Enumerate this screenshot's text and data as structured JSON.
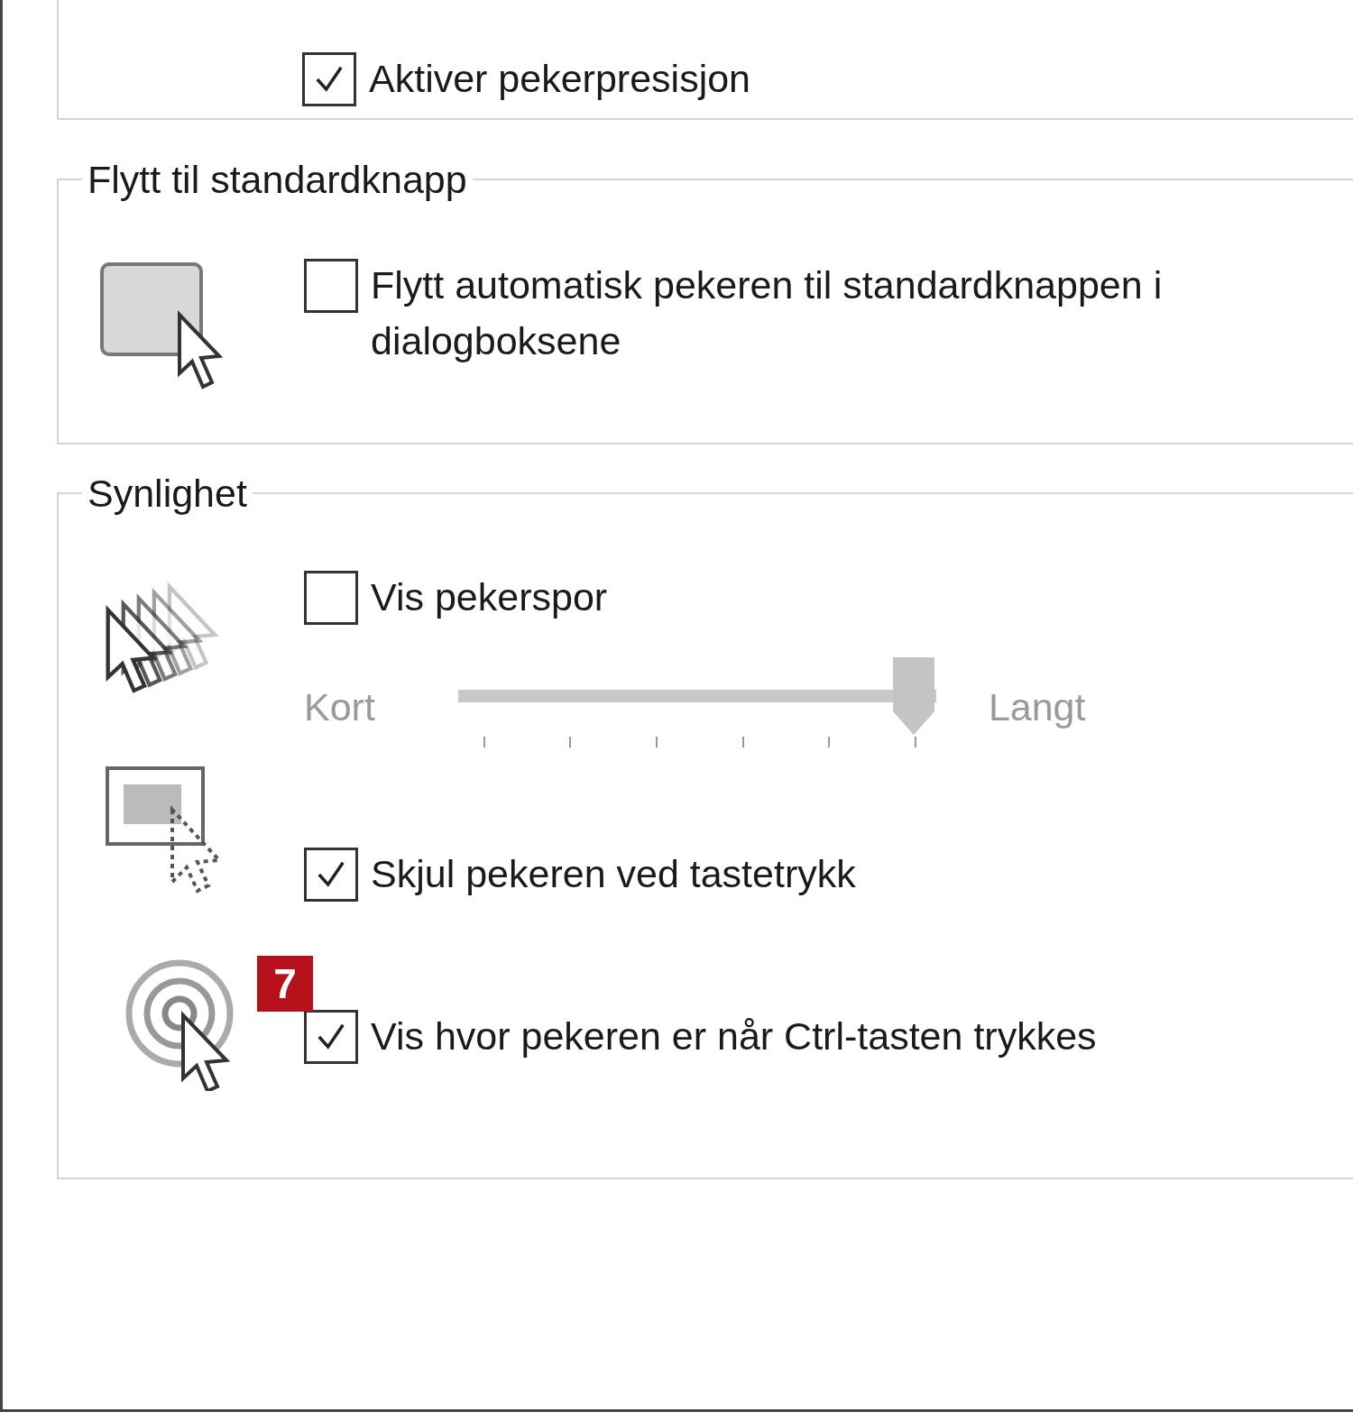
{
  "top_group": {
    "options": [
      {
        "label": "Aktiver pekerpresisjon",
        "checked": true
      }
    ]
  },
  "groups": [
    {
      "title": "Flytt til standardknapp",
      "rows": [
        {
          "kind": "checkbox",
          "label": "Flytt automatisk pekeren til standardknappen i dialogboksene",
          "checked": false
        }
      ]
    },
    {
      "title": "Synlighet",
      "rows": [
        {
          "kind": "checkbox",
          "label": "Vis pekerspor",
          "checked": false
        },
        {
          "kind": "slider",
          "min_label": "Kort",
          "max_label": "Langt",
          "level": 1,
          "disabled": true
        },
        {
          "kind": "checkbox",
          "label": "Skjul pekeren ved tastetrykk",
          "checked": true
        },
        {
          "kind": "checkbox",
          "label": "Vis hvor pekeren er når Ctrl-tasten trykkes",
          "checked": true,
          "badge": "7"
        }
      ]
    }
  ]
}
